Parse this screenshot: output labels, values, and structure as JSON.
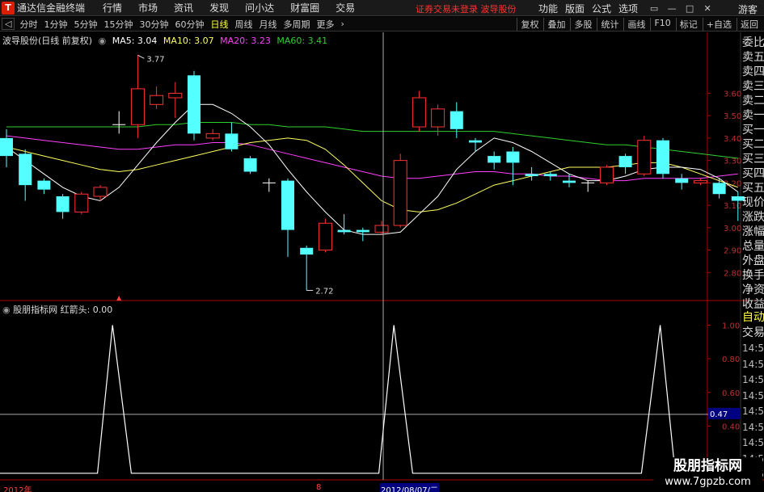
{
  "titlebar": {
    "app_title": "通达信金融终端",
    "menu": [
      "行情",
      "市场",
      "资讯",
      "发现",
      "问小达",
      "财富圈",
      "交易"
    ],
    "notice": "证券交易未登录  波导股份",
    "right_menu": [
      "功能",
      "版面",
      "公式",
      "选项"
    ],
    "guest": "游客"
  },
  "toolbar": {
    "periods": [
      "分时",
      "1分钟",
      "5分钟",
      "15分钟",
      "30分钟",
      "60分钟",
      "日线",
      "周线",
      "月线",
      "多周期",
      "更多"
    ],
    "active_period": "日线",
    "right_buttons": [
      "复权",
      "叠加",
      "多股",
      "统计",
      "画线",
      "F10",
      "标记",
      "+自选",
      "返回"
    ]
  },
  "chart_info": {
    "stock": "波导股份(日线 前复权)",
    "ma5": "MA5: 3.04",
    "ma10": "MA10: 3.07",
    "ma20": "MA20: 3.23",
    "ma60": "MA60: 3.41"
  },
  "indicator_info": {
    "name": "股朋指标网",
    "value": "红箭头: 0.00"
  },
  "side_panel": [
    "委比",
    "卖五",
    "卖四",
    "卖三",
    "卖二",
    "卖一",
    "买一",
    "买二",
    "买三",
    "买四",
    "买五",
    "现价",
    "涨跌",
    "涨幅",
    "总量",
    "外盘",
    "换手",
    "净资",
    "收益"
  ],
  "side_panel2": {
    "header1": "自动",
    "header2": "交易",
    "times": [
      "14:56",
      "14:56",
      "14:56",
      "14:56",
      "14:56",
      "14:56",
      "14:56",
      "14:56",
      "14:56"
    ]
  },
  "annotations": {
    "high": "3.77",
    "low": "2.72",
    "crosshair_value": "0.47"
  },
  "date_bar": {
    "year": "2012年",
    "month": "8",
    "cursor_date": "2012/08/07/二"
  },
  "watermark": {
    "line1": "股朋指标网",
    "line2": "www.7gpzb.com"
  },
  "colors": {
    "up": "#ff3232",
    "down": "#54ffff",
    "ma5": "#ffffff",
    "ma10": "#ffff60",
    "ma20": "#ff40ff",
    "ma60": "#30d030",
    "axis": "#b00000"
  },
  "chart_data": [
    {
      "type": "candlestick",
      "ylim": [
        2.7,
        3.8
      ],
      "y_ticks": [
        2.8,
        2.9,
        3.0,
        3.1,
        3.2,
        3.3,
        3.4,
        3.5,
        3.6
      ],
      "candles": [
        {
          "o": 3.4,
          "c": 3.32,
          "h": 3.44,
          "l": 3.27
        },
        {
          "o": 3.33,
          "c": 3.19,
          "h": 3.35,
          "l": 3.12
        },
        {
          "o": 3.21,
          "c": 3.17,
          "h": 3.22,
          "l": 3.15
        },
        {
          "o": 3.14,
          "c": 3.07,
          "h": 3.15,
          "l": 3.04
        },
        {
          "o": 3.07,
          "c": 3.15,
          "h": 3.16,
          "l": 3.06
        },
        {
          "o": 3.14,
          "c": 3.18,
          "h": 3.19,
          "l": 3.12
        },
        {
          "o": 3.46,
          "c": 3.46,
          "h": 3.52,
          "l": 3.42
        },
        {
          "o": 3.46,
          "c": 3.62,
          "h": 3.77,
          "l": 3.4
        },
        {
          "o": 3.55,
          "c": 3.59,
          "h": 3.63,
          "l": 3.53
        },
        {
          "o": 3.58,
          "c": 3.6,
          "h": 3.65,
          "l": 3.49
        },
        {
          "o": 3.68,
          "c": 3.42,
          "h": 3.7,
          "l": 3.39
        },
        {
          "o": 3.4,
          "c": 3.42,
          "h": 3.44,
          "l": 3.39
        },
        {
          "o": 3.42,
          "c": 3.35,
          "h": 3.47,
          "l": 3.34
        },
        {
          "o": 3.31,
          "c": 3.25,
          "h": 3.32,
          "l": 3.24
        },
        {
          "o": 3.2,
          "c": 3.2,
          "h": 3.22,
          "l": 3.16
        },
        {
          "o": 3.21,
          "c": 2.99,
          "h": 3.22,
          "l": 2.87
        },
        {
          "o": 2.91,
          "c": 2.88,
          "h": 2.92,
          "l": 2.72
        },
        {
          "o": 2.9,
          "c": 3.02,
          "h": 3.04,
          "l": 2.89
        },
        {
          "o": 2.99,
          "c": 2.98,
          "h": 3.06,
          "l": 2.97
        },
        {
          "o": 2.99,
          "c": 2.98,
          "h": 3.0,
          "l": 2.94
        },
        {
          "o": 2.98,
          "c": 3.01,
          "h": 3.03,
          "l": 2.97
        },
        {
          "o": 3.01,
          "c": 3.3,
          "h": 3.33,
          "l": 3.0
        },
        {
          "o": 3.45,
          "c": 3.58,
          "h": 3.61,
          "l": 3.43
        },
        {
          "o": 3.45,
          "c": 3.53,
          "h": 3.55,
          "l": 3.41
        },
        {
          "o": 3.52,
          "c": 3.44,
          "h": 3.56,
          "l": 3.4
        },
        {
          "o": 3.39,
          "c": 3.38,
          "h": 3.4,
          "l": 3.34
        },
        {
          "o": 3.32,
          "c": 3.29,
          "h": 3.34,
          "l": 3.26
        },
        {
          "o": 3.34,
          "c": 3.29,
          "h": 3.36,
          "l": 3.19
        },
        {
          "o": 3.24,
          "c": 3.23,
          "h": 3.27,
          "l": 3.21
        },
        {
          "o": 3.24,
          "c": 3.23,
          "h": 3.25,
          "l": 3.21
        },
        {
          "o": 3.21,
          "c": 3.2,
          "h": 3.24,
          "l": 3.18
        },
        {
          "o": 3.2,
          "c": 3.2,
          "h": 3.21,
          "l": 3.16
        },
        {
          "o": 3.2,
          "c": 3.27,
          "h": 3.28,
          "l": 3.19
        },
        {
          "o": 3.32,
          "c": 3.27,
          "h": 3.33,
          "l": 3.24
        },
        {
          "o": 3.24,
          "c": 3.39,
          "h": 3.41,
          "l": 3.23
        },
        {
          "o": 3.39,
          "c": 3.24,
          "h": 3.4,
          "l": 3.22
        },
        {
          "o": 3.22,
          "c": 3.2,
          "h": 3.24,
          "l": 3.17
        },
        {
          "o": 3.2,
          "c": 3.21,
          "h": 3.22,
          "l": 3.19
        },
        {
          "o": 3.2,
          "c": 3.15,
          "h": 3.22,
          "l": 3.13
        },
        {
          "o": 3.14,
          "c": 3.12,
          "h": 3.16,
          "l": 3.03
        }
      ],
      "ma5": [
        3.36,
        3.3,
        3.24,
        3.18,
        3.14,
        3.12,
        3.18,
        3.28,
        3.38,
        3.47,
        3.55,
        3.55,
        3.51,
        3.45,
        3.37,
        3.26,
        3.16,
        3.07,
        2.99,
        2.97,
        2.97,
        2.98,
        3.06,
        3.14,
        3.26,
        3.34,
        3.4,
        3.38,
        3.34,
        3.29,
        3.24,
        3.21,
        3.21,
        3.23,
        3.26,
        3.27,
        3.27,
        3.26,
        3.22,
        3.16
      ],
      "ma10": [
        3.36,
        3.34,
        3.32,
        3.3,
        3.28,
        3.26,
        3.25,
        3.26,
        3.28,
        3.3,
        3.32,
        3.34,
        3.36,
        3.38,
        3.39,
        3.4,
        3.39,
        3.35,
        3.28,
        3.2,
        3.12,
        3.08,
        3.07,
        3.08,
        3.11,
        3.15,
        3.19,
        3.21,
        3.23,
        3.25,
        3.27,
        3.27,
        3.27,
        3.28,
        3.29,
        3.29,
        3.27,
        3.24,
        3.21,
        3.18
      ],
      "ma20": [
        3.41,
        3.4,
        3.39,
        3.38,
        3.37,
        3.36,
        3.35,
        3.35,
        3.36,
        3.37,
        3.37,
        3.38,
        3.38,
        3.37,
        3.35,
        3.33,
        3.31,
        3.29,
        3.27,
        3.25,
        3.23,
        3.22,
        3.22,
        3.23,
        3.24,
        3.25,
        3.25,
        3.24,
        3.24,
        3.23,
        3.23,
        3.22,
        3.21,
        3.21,
        3.22,
        3.22,
        3.22,
        3.22,
        3.23,
        3.24
      ],
      "ma60": [
        3.45,
        3.45,
        3.45,
        3.45,
        3.45,
        3.45,
        3.45,
        3.45,
        3.46,
        3.46,
        3.47,
        3.47,
        3.47,
        3.46,
        3.46,
        3.45,
        3.45,
        3.45,
        3.44,
        3.43,
        3.43,
        3.43,
        3.43,
        3.43,
        3.43,
        3.43,
        3.43,
        3.42,
        3.41,
        3.4,
        3.39,
        3.38,
        3.37,
        3.37,
        3.36,
        3.35,
        3.34,
        3.33,
        3.32,
        3.31
      ]
    },
    {
      "type": "line",
      "title": "红箭头",
      "ylim": [
        0.1,
        1.05
      ],
      "y_ticks": [
        0.2,
        0.4,
        0.6,
        0.8,
        1.0
      ],
      "x": [
        0,
        3.8,
        5.2,
        6.0,
        7.0,
        18.0,
        19.2,
        20.2,
        21.0,
        22.0,
        33.0,
        34.2,
        35.2,
        36.0,
        40.0
      ],
      "values": [
        0,
        0,
        0,
        1,
        0,
        0,
        0,
        0,
        1,
        0,
        0,
        0,
        1,
        0,
        0
      ]
    }
  ]
}
